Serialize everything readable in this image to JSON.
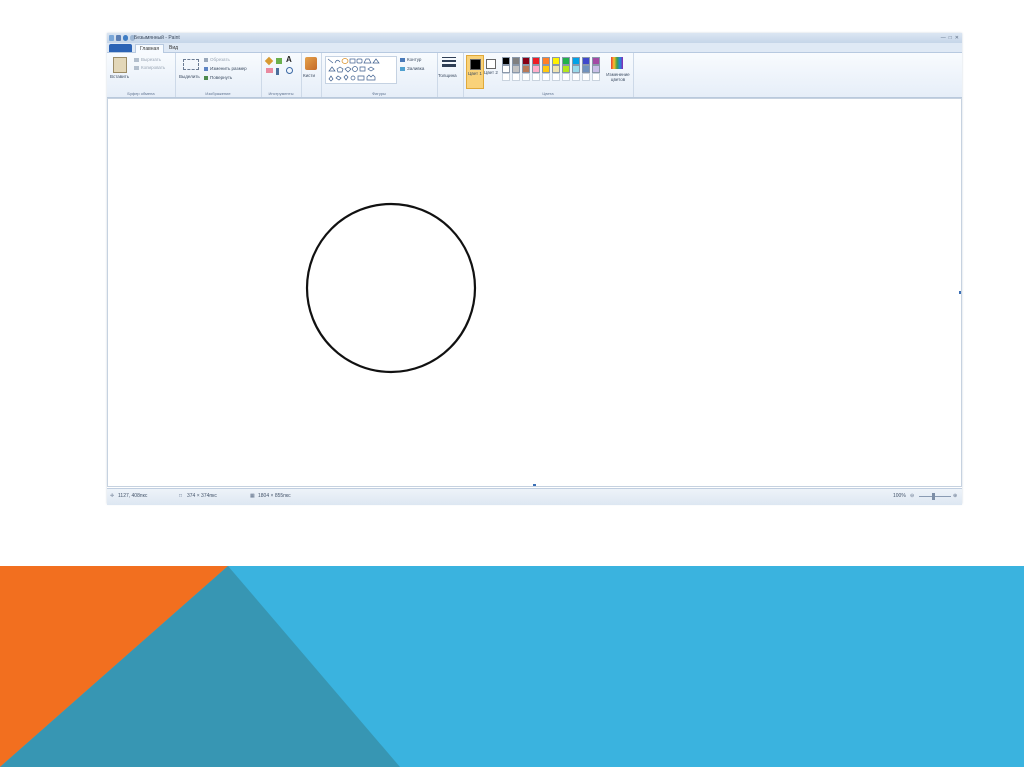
{
  "window": {
    "title": "Безымянный - Paint"
  },
  "tabs": [
    {
      "label": "Главная"
    },
    {
      "label": "Вид"
    }
  ],
  "ribbon": {
    "clipboard": {
      "paste_label": "Вставить",
      "cut_label": "Вырезать",
      "copy_label": "Копировать",
      "group_label": "Буфер обмена"
    },
    "image": {
      "select_label": "Выделить",
      "crop_label": "Обрезать",
      "resize_label": "Изменить размер",
      "rotate_label": "Повернуть",
      "group_label": "Изображение"
    },
    "tools": {
      "group_label": "Инструменты"
    },
    "brushes": {
      "label": "Кисти"
    },
    "shapes": {
      "outline_label": "Контур",
      "fill_label": "Заливка",
      "group_label": "Фигуры"
    },
    "size": {
      "label": "Толщина"
    },
    "colors": {
      "color1_label": "Цвет 1",
      "color2_label": "Цвет 2",
      "edit_label": "Изменение цветов",
      "group_label": "Цвета",
      "color1": "#000000",
      "color2": "#ffffff",
      "palette_row1": [
        "#000000",
        "#7f7f7f",
        "#880015",
        "#ed1c24",
        "#ff7f27",
        "#fff200",
        "#22b14c",
        "#00a2e8",
        "#3f48cc",
        "#a349a4"
      ],
      "palette_row2": [
        "#ffffff",
        "#c3c3c3",
        "#b97a57",
        "#ffaec9",
        "#ffc90e",
        "#efe4b0",
        "#b5e61d",
        "#99d9ea",
        "#7092be",
        "#c8bfe7"
      ]
    }
  },
  "status": {
    "cursor_pos": "1127, 408пкс",
    "selection_size": "374 × 374пкс",
    "image_size": "1804 × 855пкс",
    "zoom": "100%"
  },
  "slide": {
    "orange": "#f26f1f",
    "blue": "#3ab3df",
    "teal": "#3796b3"
  }
}
